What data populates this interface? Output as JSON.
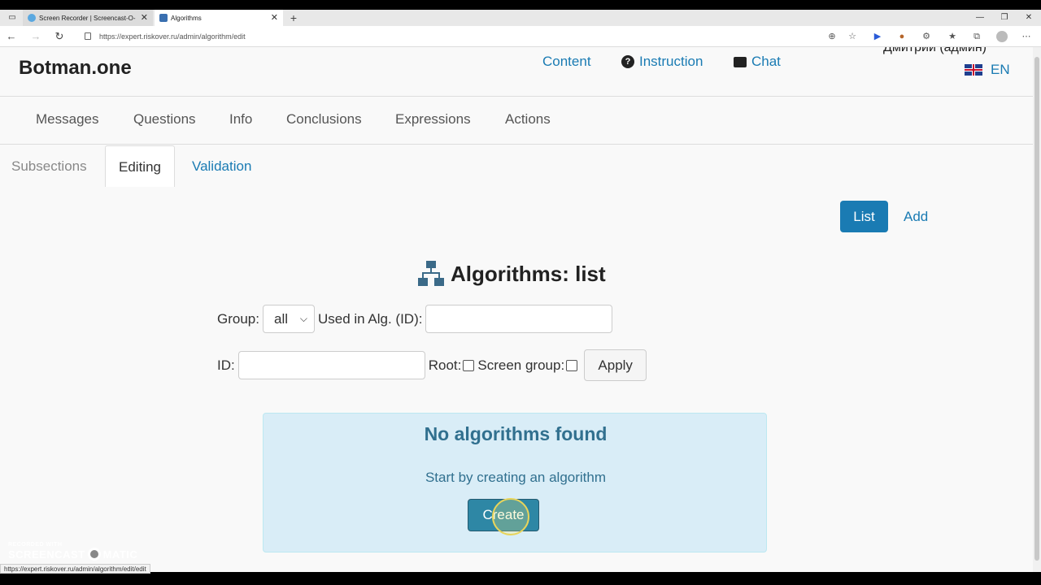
{
  "browser": {
    "tabs": [
      {
        "title": "Screen Recorder | Screencast-O-"
      },
      {
        "title": "Algorithms"
      }
    ],
    "new_tab": "+",
    "url": "https://expert.riskover.ru/admin/algorithm/edit",
    "status_url": "https://expert.riskover.ru/admin/algorithm/edit/edit"
  },
  "header": {
    "brand": "Botman.one",
    "links": {
      "content": "Content",
      "instruction": "Instruction",
      "chat": "Chat"
    },
    "user": "Дмитрий (админ)",
    "lang": "EN"
  },
  "main_nav": [
    "Messages",
    "Questions",
    "Info",
    "Conclusions",
    "Expressions",
    "Actions"
  ],
  "sub_tabs": {
    "subsections": "Subsections",
    "editing": "Editing",
    "validation": "Validation"
  },
  "actions": {
    "list": "List",
    "add": "Add"
  },
  "page_title": "Algorithms: list",
  "filters": {
    "group_label": "Group:",
    "group_value": "all",
    "used_in_label": "Used in Alg. (ID):",
    "id_label": "ID:",
    "root_label": "Root:",
    "screen_group_label": "Screen group:",
    "apply": "Apply"
  },
  "empty_state": {
    "title": "No algorithms found",
    "text": "Start by creating an algorithm",
    "create": "Create"
  },
  "watermark": {
    "line1": "RECORDED WITH",
    "left": "SCREENCAST",
    "right": "MATIC"
  },
  "colors": {
    "accent": "#1a7bb3",
    "alert_bg": "#d9edf7",
    "alert_text": "#31708f"
  }
}
